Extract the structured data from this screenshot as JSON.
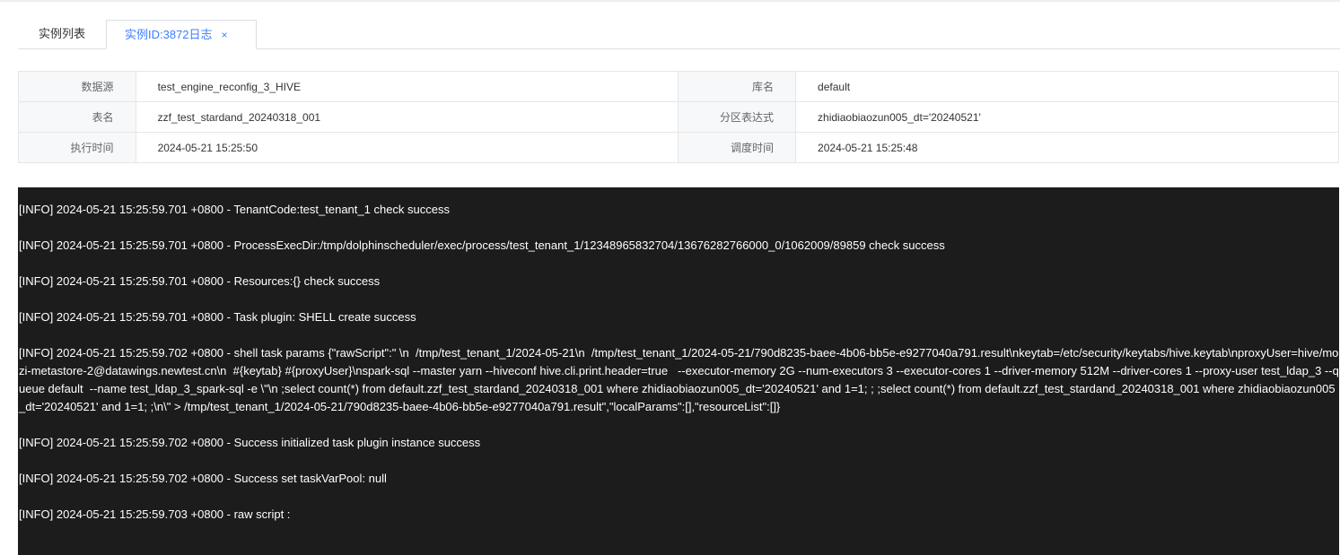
{
  "tabs": [
    {
      "label": "实例列表"
    },
    {
      "label": "实例ID:3872日志",
      "close": "×"
    }
  ],
  "info": {
    "datasource_label": "数据源",
    "datasource_value": "test_engine_reconfig_3_HIVE",
    "db_label": "库名",
    "db_value": "default",
    "table_label": "表名",
    "table_value": "zzf_test_stardand_20240318_001",
    "partition_label": "分区表达式",
    "partition_value": "zhidiaobiaozun005_dt='20240521'",
    "exec_time_label": "执行时间",
    "exec_time_value": "2024-05-21 15:25:50",
    "sched_time_label": "调度时间",
    "sched_time_value": "2024-05-21 15:25:48"
  },
  "log": {
    "lines": [
      "[INFO] 2024-05-21 15:25:59.701 +0800 - TenantCode:test_tenant_1 check success",
      "[INFO] 2024-05-21 15:25:59.701 +0800 - ProcessExecDir:/tmp/dolphinscheduler/exec/process/test_tenant_1/12348965832704/13676282766000_0/1062009/89859 check success",
      "[INFO] 2024-05-21 15:25:59.701 +0800 - Resources:{} check success",
      "[INFO] 2024-05-21 15:25:59.701 +0800 - Task plugin: SHELL create success",
      "[INFO] 2024-05-21 15:25:59.702 +0800 - shell task params {\"rawScript\":\" \\n  /tmp/test_tenant_1/2024-05-21\\n  /tmp/test_tenant_1/2024-05-21/790d8235-baee-4b06-bb5e-e9277040a791.result\\nkeytab=/etc/security/keytabs/hive.keytab\\nproxyUser=hive/mozi-metastore-2@datawings.newtest.cn\\n  #{keytab} #{proxyUser}\\nspark-sql --master yarn --hiveconf hive.cli.print.header=true   --executor-memory 2G --num-executors 3 --executor-cores 1 --driver-memory 512M --driver-cores 1 --proxy-user test_ldap_3 --queue default  --name test_ldap_3_spark-sql -e \\\"\\n ;select count(*) from default.zzf_test_stardand_20240318_001 where zhidiaobiaozun005_dt='20240521' and 1=1; ; ;select count(*) from default.zzf_test_stardand_20240318_001 where zhidiaobiaozun005_dt='20240521' and 1=1; ;\\n\\\" > /tmp/test_tenant_1/2024-05-21/790d8235-baee-4b06-bb5e-e9277040a791.result\",\"localParams\":[],\"resourceList\":[]}",
      "[INFO] 2024-05-21 15:25:59.702 +0800 - Success initialized task plugin instance success",
      "[INFO] 2024-05-21 15:25:59.702 +0800 - Success set taskVarPool: null",
      "[INFO] 2024-05-21 15:25:59.703 +0800 - raw script :"
    ]
  }
}
